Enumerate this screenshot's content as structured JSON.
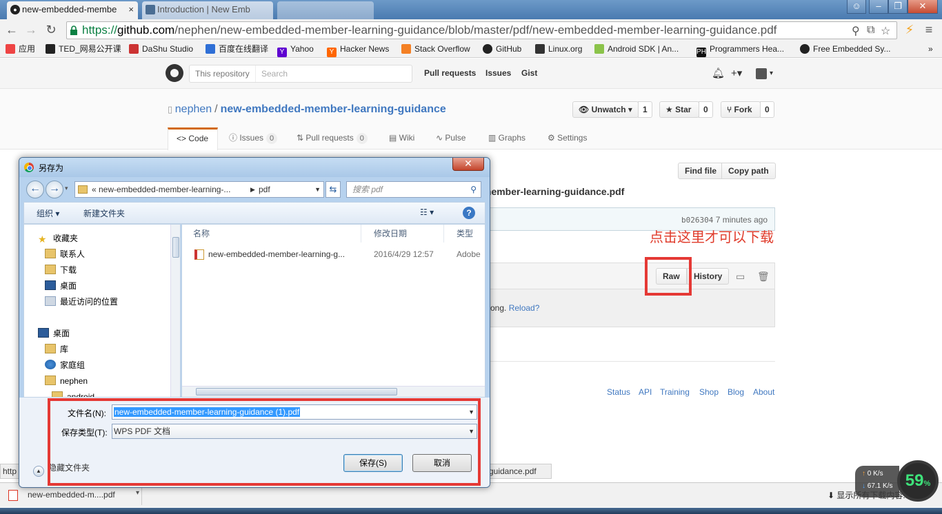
{
  "browser": {
    "tabs": [
      {
        "label": "new-embedded-membe",
        "active": true
      },
      {
        "label": "Introduction | New Emb",
        "active": false
      },
      {
        "label": "",
        "active": false
      }
    ],
    "url_scheme": "https://",
    "url_host": "github.com",
    "url_path": "/nephen/new-embedded-member-learning-guidance/blob/master/pdf/new-embedded-member-learning-guidance.pdf",
    "bookmarks": [
      {
        "label": "应用",
        "color": "#e44"
      },
      {
        "label": "TED_网易公开课",
        "color": "#222"
      },
      {
        "label": "DaShu Studio",
        "color": "#c33"
      },
      {
        "label": "百度在线翻译",
        "color": "#2f6fd6"
      },
      {
        "label": "Yahoo",
        "color": "#5f01d1"
      },
      {
        "label": "Hacker News",
        "color": "#f60"
      },
      {
        "label": "Stack Overflow",
        "color": "#f48024"
      },
      {
        "label": "GitHub",
        "color": "#222"
      },
      {
        "label": "Linux.org",
        "color": "#333"
      },
      {
        "label": "Android SDK | An...",
        "color": "#8bc34a"
      },
      {
        "label": "Programmers Hea...",
        "color": "#111"
      },
      {
        "label": "Free Embedded Sy...",
        "color": "#222"
      }
    ]
  },
  "github": {
    "search_scope": "This repository",
    "search_placeholder": "Search",
    "nav": [
      "Pull requests",
      "Issues",
      "Gist"
    ],
    "owner": "nephen",
    "repo": "new-embedded-member-learning-guidance",
    "unwatch_label": "Unwatch",
    "unwatch_count": "1",
    "star_label": "Star",
    "star_count": "0",
    "fork_label": "Fork",
    "fork_count": "0",
    "tabs": [
      {
        "label": "Code"
      },
      {
        "label": "Issues",
        "count": "0"
      },
      {
        "label": "Pull requests",
        "count": "0"
      },
      {
        "label": "Wiki"
      },
      {
        "label": "Pulse"
      },
      {
        "label": "Graphs"
      },
      {
        "label": "Settings"
      }
    ],
    "find_file": "Find file",
    "copy_path": "Copy path",
    "file_title": "member-learning-guidance.pdf",
    "commit_sha": "b026304",
    "commit_time": "7 minutes ago",
    "raw_label": "Raw",
    "history_label": "History",
    "render_error": "rong.",
    "reload_label": "Reload?",
    "annotation": "点击这里才可以下载",
    "footer_links": [
      "Status",
      "API",
      "Training",
      "Shop",
      "Blog",
      "About"
    ]
  },
  "status": {
    "left": "http",
    "right": "-guidance.pdf"
  },
  "download": {
    "filename": "new-embedded-m....pdf",
    "show_all": "显示所有下载内容..."
  },
  "netspeed": {
    "up": "0 K/s",
    "down": "67.1 K/s",
    "percent": "59",
    "percent_sign": "%"
  },
  "dialog": {
    "title": "另存为",
    "path_crumb1": "«   new-embedded-member-learning-...",
    "path_crumb2": "pdf",
    "search_placeholder": "搜索 pdf",
    "organize": "组织 ▾",
    "new_folder": "新建文件夹",
    "nav_items": [
      {
        "label": "收藏夹",
        "icon": "star-icon"
      },
      {
        "label": "联系人",
        "icon": "contacts-icon"
      },
      {
        "label": "下载",
        "icon": "download-folder-icon"
      },
      {
        "label": "桌面",
        "icon": "desktop-icon"
      },
      {
        "label": "最近访问的位置",
        "icon": "recent-icon"
      },
      {
        "label": "桌面",
        "icon": "desktop-icon"
      },
      {
        "label": "库",
        "icon": "library-icon"
      },
      {
        "label": "家庭组",
        "icon": "homegroup-icon"
      },
      {
        "label": "nephen",
        "icon": "user-folder-icon"
      },
      {
        "label": "android",
        "icon": "folder-icon"
      }
    ],
    "columns": [
      "名称",
      "修改日期",
      "类型"
    ],
    "file": {
      "name": "new-embedded-member-learning-g...",
      "date": "2016/4/29 12:57",
      "type": "Adobe"
    },
    "filename_label": "文件名(N):",
    "filename_value": "new-embedded-member-learning-guidance (1).pdf",
    "filetype_label": "保存类型(T):",
    "filetype_value": "WPS PDF 文档",
    "save_button": "保存(S)",
    "cancel_button": "取消",
    "hide_folders": "隐藏文件夹"
  }
}
